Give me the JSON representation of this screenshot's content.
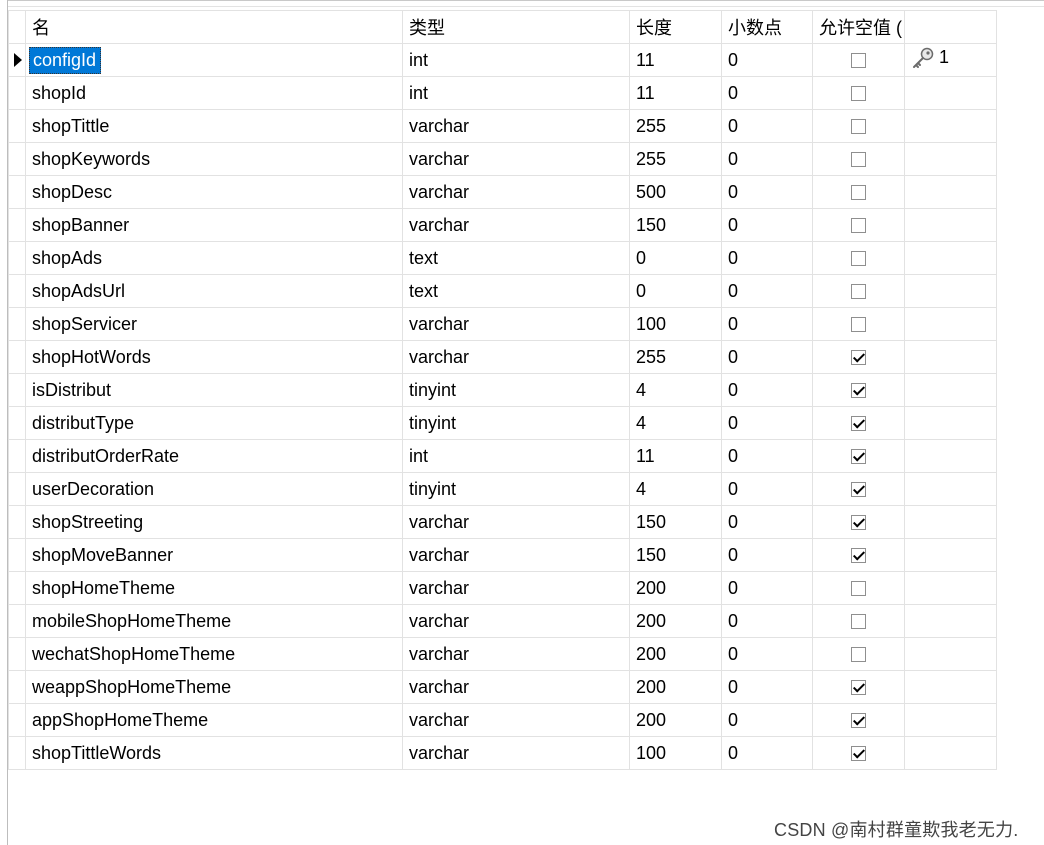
{
  "columns": {
    "name": "名",
    "type": "类型",
    "length": "长度",
    "decimals": "小数点",
    "nullable": "允许空值 ("
  },
  "rows": [
    {
      "name": "configId",
      "type": "int",
      "length": "11",
      "decimals": "0",
      "nullable": false,
      "key": "1",
      "selected": true
    },
    {
      "name": "shopId",
      "type": "int",
      "length": "11",
      "decimals": "0",
      "nullable": false
    },
    {
      "name": "shopTittle",
      "type": "varchar",
      "length": "255",
      "decimals": "0",
      "nullable": false
    },
    {
      "name": "shopKeywords",
      "type": "varchar",
      "length": "255",
      "decimals": "0",
      "nullable": false
    },
    {
      "name": "shopDesc",
      "type": "varchar",
      "length": "500",
      "decimals": "0",
      "nullable": false
    },
    {
      "name": "shopBanner",
      "type": "varchar",
      "length": "150",
      "decimals": "0",
      "nullable": false
    },
    {
      "name": "shopAds",
      "type": "text",
      "length": "0",
      "decimals": "0",
      "nullable": false
    },
    {
      "name": "shopAdsUrl",
      "type": "text",
      "length": "0",
      "decimals": "0",
      "nullable": false
    },
    {
      "name": "shopServicer",
      "type": "varchar",
      "length": "100",
      "decimals": "0",
      "nullable": false
    },
    {
      "name": "shopHotWords",
      "type": "varchar",
      "length": "255",
      "decimals": "0",
      "nullable": true
    },
    {
      "name": "isDistribut",
      "type": "tinyint",
      "length": "4",
      "decimals": "0",
      "nullable": true
    },
    {
      "name": "distributType",
      "type": "tinyint",
      "length": "4",
      "decimals": "0",
      "nullable": true
    },
    {
      "name": "distributOrderRate",
      "type": "int",
      "length": "11",
      "decimals": "0",
      "nullable": true
    },
    {
      "name": "userDecoration",
      "type": "tinyint",
      "length": "4",
      "decimals": "0",
      "nullable": true
    },
    {
      "name": "shopStreeting",
      "type": "varchar",
      "length": "150",
      "decimals": "0",
      "nullable": true
    },
    {
      "name": "shopMoveBanner",
      "type": "varchar",
      "length": "150",
      "decimals": "0",
      "nullable": true
    },
    {
      "name": "shopHomeTheme",
      "type": "varchar",
      "length": "200",
      "decimals": "0",
      "nullable": false
    },
    {
      "name": "mobileShopHomeTheme",
      "type": "varchar",
      "length": "200",
      "decimals": "0",
      "nullable": false
    },
    {
      "name": "wechatShopHomeTheme",
      "type": "varchar",
      "length": "200",
      "decimals": "0",
      "nullable": false
    },
    {
      "name": "weappShopHomeTheme",
      "type": "varchar",
      "length": "200",
      "decimals": "0",
      "nullable": true
    },
    {
      "name": "appShopHomeTheme",
      "type": "varchar",
      "length": "200",
      "decimals": "0",
      "nullable": true
    },
    {
      "name": "shopTittleWords",
      "type": "varchar",
      "length": "100",
      "decimals": "0",
      "nullable": true
    }
  ],
  "watermark": "CSDN @南村群童欺我老无力.",
  "colors": {
    "selection": "#0078d7",
    "grid_line": "#e2e2e2"
  },
  "icons": {
    "key": "key-icon",
    "row_pointer": "row-pointer-icon"
  }
}
